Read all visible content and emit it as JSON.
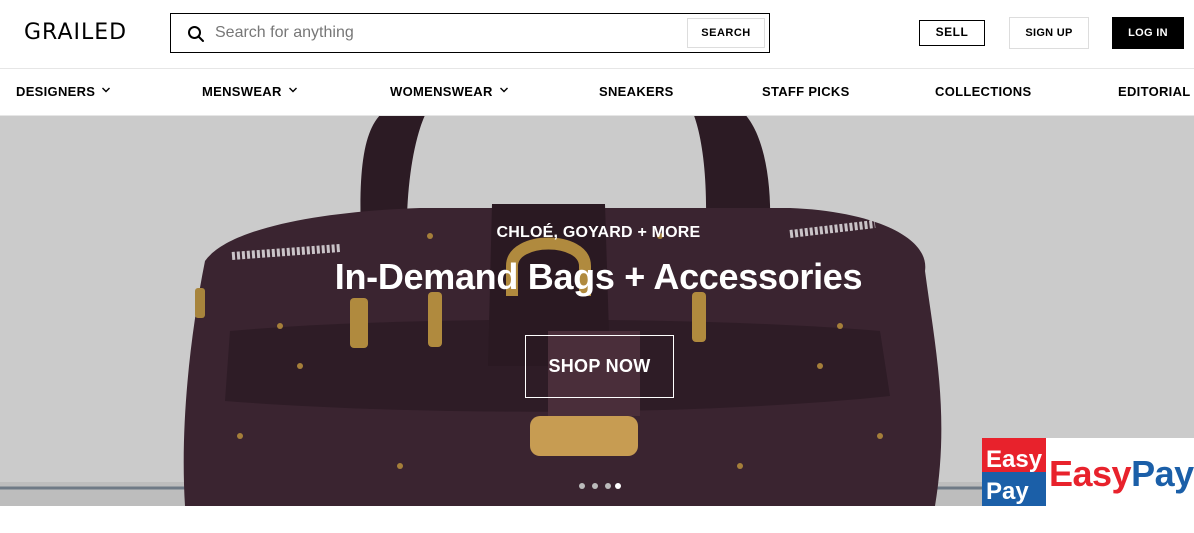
{
  "header": {
    "logo": "GRAILED",
    "search": {
      "placeholder": "Search for anything",
      "button_label": "SEARCH"
    },
    "sell_label": "SELL",
    "signup_label": "SIGN UP",
    "login_label": "LOG IN"
  },
  "nav": {
    "items": [
      {
        "label": "DESIGNERS",
        "dropdown": true
      },
      {
        "label": "MENSWEAR",
        "dropdown": true
      },
      {
        "label": "WOMENSWEAR",
        "dropdown": true
      },
      {
        "label": "SNEAKERS",
        "dropdown": false
      },
      {
        "label": "STAFF PICKS",
        "dropdown": false
      },
      {
        "label": "COLLECTIONS",
        "dropdown": false
      },
      {
        "label": "EDITORIAL",
        "dropdown": false
      }
    ]
  },
  "hero": {
    "eyebrow": "CHLOÉ, GOYARD + MORE",
    "title": "In-Demand Bags + Accessories",
    "cta_label": "SHOP NOW",
    "slide_count": 4,
    "active_slide": 4
  },
  "easypay": {
    "badge_line1": "Easy",
    "badge_line2": "Pay",
    "word_easy": "Easy",
    "word_pay": "Pay"
  },
  "colors": {
    "accent": "#000000",
    "hero_bg": "#cbcbcb",
    "bag": "#3a2430",
    "easypay_red": "#e8222c",
    "easypay_blue": "#1b5fa8"
  }
}
